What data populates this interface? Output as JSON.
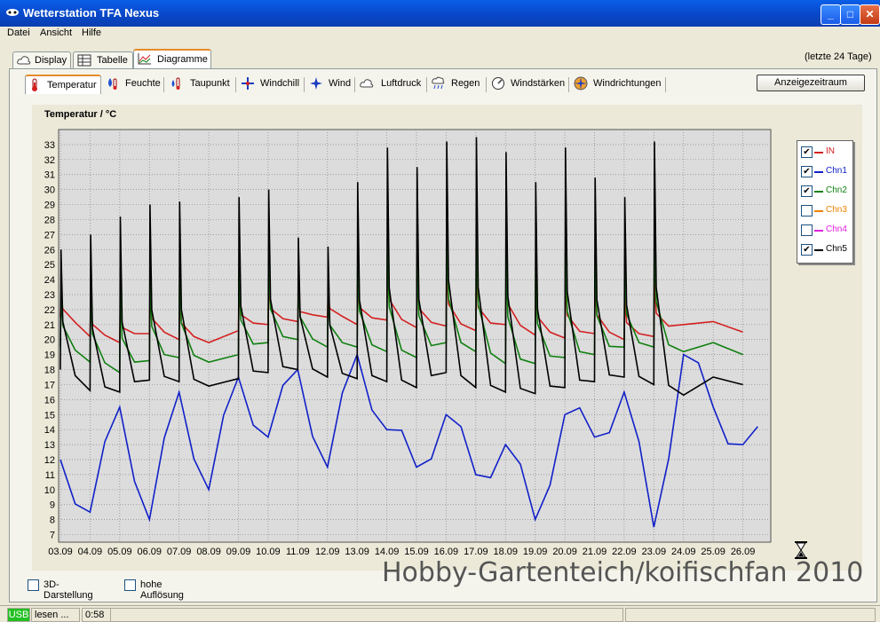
{
  "window": {
    "title": "Wetterstation TFA Nexus"
  },
  "menu": [
    "Datei",
    "Ansicht",
    "Hilfe"
  ],
  "main_tabs": [
    "Display",
    "Tabelle",
    "Diagramme"
  ],
  "range_label": "(letzte 24 Tage)",
  "sub_tabs": [
    "Temperatur",
    "Feuchte",
    "Taupunkt",
    "Windchill",
    "Wind",
    "Luftdruck",
    "Regen",
    "Windstärken",
    "Windrichtungen"
  ],
  "display_period_button": "Anzeigezeitraum",
  "options": {
    "three_d": "3D-Darstellung",
    "high_res": "hohe Auflösung"
  },
  "status": {
    "usb": "USB",
    "state": "lesen ...",
    "time": "0:58"
  },
  "watermark": "Hobby-Gartenteich/koifischfan 2010",
  "colors": {
    "IN": "#d42020",
    "Chn1": "#1020c8",
    "Chn2": "#108010",
    "Chn3": "#f08000",
    "Chn4": "#e020e0",
    "Chn5": "#000000",
    "plot_bg": "#dcdcdc"
  },
  "chart_data": {
    "type": "line",
    "title": "Temperatur / °C",
    "ylim": [
      6.5,
      34
    ],
    "yticks": [
      7,
      8,
      9,
      10,
      11,
      12,
      13,
      14,
      15,
      16,
      17,
      18,
      19,
      20,
      21,
      22,
      23,
      24,
      25,
      26,
      27,
      28,
      29,
      30,
      31,
      32,
      33
    ],
    "categories": [
      "03.09",
      "04.09",
      "05.09",
      "06.09",
      "07.09",
      "08.09",
      "09.09",
      "10.09",
      "11.09",
      "12.09",
      "13.09",
      "14.09",
      "15.09",
      "16.09",
      "17.09",
      "18.09",
      "19.09",
      "20.09",
      "21.09",
      "22.09",
      "23.09",
      "24.09",
      "25.09",
      "26.09"
    ],
    "grid": true,
    "legend_position": "right",
    "series": [
      {
        "name": "IN",
        "checked": true,
        "values": [
          21.5,
          20.2,
          19.8,
          20.4,
          20.0,
          19.8,
          20.6,
          21.0,
          21.2,
          21.5,
          21.0,
          21.3,
          20.8,
          20.9,
          20.6,
          21.0,
          20.3,
          20.1,
          20.4,
          20.0,
          20.2,
          21.0,
          21.2,
          20.5
        ]
      },
      {
        "name": "Chn1",
        "checked": true,
        "values": [
          12.0,
          8.5,
          15.5,
          8.0,
          16.5,
          10.0,
          17.5,
          13.5,
          18.0,
          11.5,
          19.0,
          14.0,
          11.5,
          15.0,
          11.0,
          13.0,
          8.0,
          15.0,
          13.5,
          16.5,
          7.5,
          19.0,
          15.5,
          13.0
        ]
      },
      {
        "name": "Chn2",
        "checked": true,
        "values": [
          19.5,
          18.5,
          17.8,
          18.6,
          18.8,
          18.5,
          19.0,
          19.8,
          20.0,
          19.5,
          19.5,
          19.2,
          18.8,
          19.8,
          19.2,
          18.4,
          18.4,
          18.8,
          19.0,
          19.5,
          19.5,
          19.2,
          19.8,
          19.0
        ]
      },
      {
        "name": "Chn3",
        "checked": false,
        "values": []
      },
      {
        "name": "Chn4",
        "checked": false,
        "values": []
      },
      {
        "name": "Chn5",
        "checked": true,
        "values": [
          18.0,
          16.6,
          16.5,
          17.3,
          17.2,
          16.9,
          17.4,
          17.8,
          18.0,
          17.5,
          17.4,
          17.2,
          16.8,
          17.8,
          16.8,
          16.5,
          16.4,
          16.8,
          17.2,
          17.5,
          17.0,
          16.3,
          17.5,
          17.0
        ]
      }
    ],
    "peaks": [
      {
        "date": "03.09",
        "value": 26.0
      },
      {
        "date": "04.09",
        "value": 27.0
      },
      {
        "date": "05.09",
        "value": 28.2
      },
      {
        "date": "06.09",
        "value": 29.0
      },
      {
        "date": "07.09",
        "value": 29.2
      },
      {
        "date": "09.09",
        "value": 29.5
      },
      {
        "date": "10.09",
        "value": 30.0
      },
      {
        "date": "11.09",
        "value": 26.8
      },
      {
        "date": "12.09",
        "value": 26.2
      },
      {
        "date": "13.09",
        "value": 30.5
      },
      {
        "date": "14.09",
        "value": 32.8
      },
      {
        "date": "15.09",
        "value": 31.5
      },
      {
        "date": "16.09",
        "value": 33.2
      },
      {
        "date": "17.09",
        "value": 33.5
      },
      {
        "date": "18.09",
        "value": 32.5
      },
      {
        "date": "19.09",
        "value": 30.5
      },
      {
        "date": "20.09",
        "value": 32.8
      },
      {
        "date": "21.09",
        "value": 30.8
      },
      {
        "date": "22.09",
        "value": 29.5
      },
      {
        "date": "23.09",
        "value": 33.2
      }
    ]
  }
}
